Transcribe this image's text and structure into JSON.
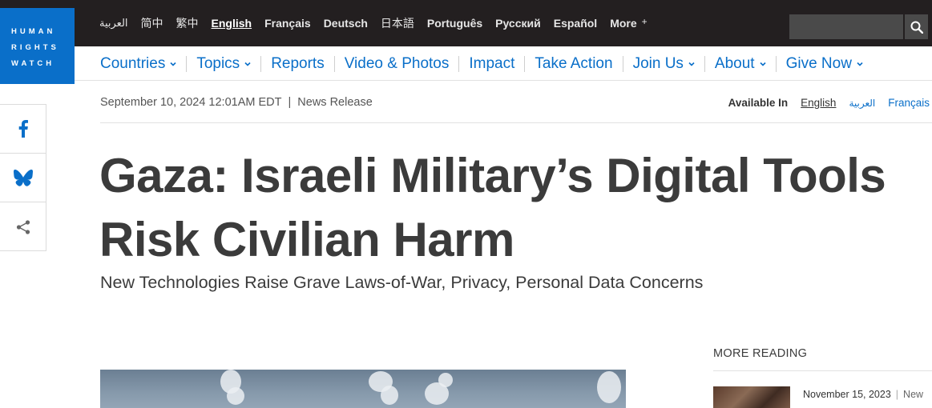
{
  "logo": {
    "lines": [
      "HUMAN",
      "RIGHTS",
      "WATCH"
    ]
  },
  "languages": [
    {
      "label": "العربية",
      "style": "ar",
      "active": false
    },
    {
      "label": "简中",
      "style": "cjk",
      "active": false
    },
    {
      "label": "繁中",
      "style": "cjk",
      "active": false
    },
    {
      "label": "English",
      "style": "",
      "active": true
    },
    {
      "label": "Français",
      "style": "",
      "active": false
    },
    {
      "label": "Deutsch",
      "style": "",
      "active": false
    },
    {
      "label": "日本語",
      "style": "cjk",
      "active": false
    },
    {
      "label": "Português",
      "style": "",
      "active": false
    },
    {
      "label": "Русский",
      "style": "",
      "active": false
    },
    {
      "label": "Español",
      "style": "",
      "active": false
    }
  ],
  "more_language": {
    "label": "More",
    "symbol": "+"
  },
  "search": {
    "placeholder": "",
    "icon": "search-icon"
  },
  "nav": [
    {
      "label": "Countries",
      "dropdown": true
    },
    {
      "label": "Topics",
      "dropdown": true
    },
    {
      "label": "Reports",
      "dropdown": false
    },
    {
      "label": "Video & Photos",
      "dropdown": false
    },
    {
      "label": "Impact",
      "dropdown": false
    },
    {
      "label": "Take Action",
      "dropdown": false
    },
    {
      "label": "Join Us",
      "dropdown": true
    },
    {
      "label": "About",
      "dropdown": true
    },
    {
      "label": "Give Now",
      "dropdown": true
    }
  ],
  "share": [
    {
      "name": "facebook-icon"
    },
    {
      "name": "bluesky-icon"
    },
    {
      "name": "share-icon"
    }
  ],
  "article": {
    "date": "September 10, 2024 12:01AM EDT",
    "separator": "|",
    "type": "News Release",
    "available_in_label": "Available In",
    "available_in": [
      {
        "label": "English",
        "style": "current"
      },
      {
        "label": "العربية",
        "style": "ar"
      },
      {
        "label": "Français",
        "style": "blue"
      }
    ],
    "headline": "Gaza: Israeli Military’s Digital Tools Risk Civilian Harm",
    "subhead": "New Technologies Raise Grave Laws-of-War, Privacy, Personal Data Concerns"
  },
  "more_reading": {
    "title": "MORE READING",
    "items": [
      {
        "date": "November 15, 2023",
        "separator": "|",
        "type": "New"
      }
    ]
  },
  "colors": {
    "brand_blue": "#0a6fc9",
    "topbar": "#231f20",
    "text": "#3b3b3b"
  }
}
